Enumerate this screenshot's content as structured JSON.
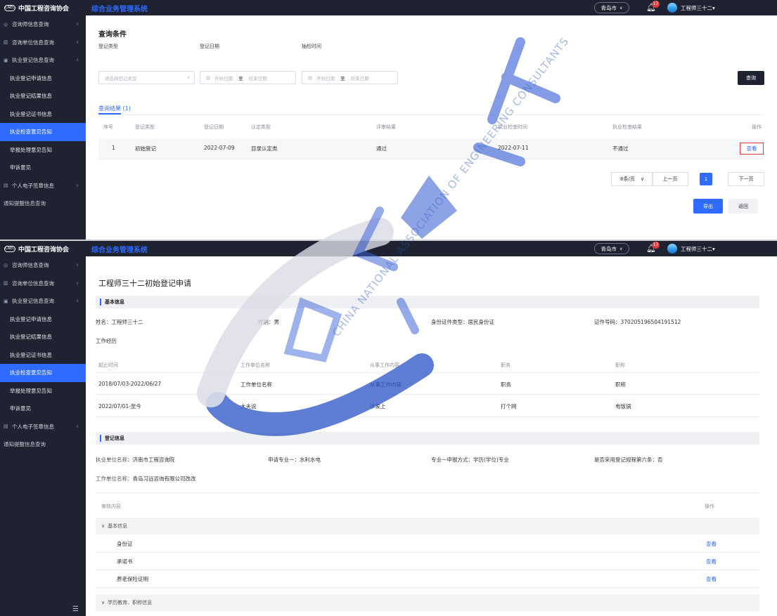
{
  "header": {
    "logo_mark": "CAEC",
    "logo_text": "中国工程咨询协会",
    "app_title": "综合业务管理系统",
    "city": "青岛市",
    "notifications": "17",
    "user": "工程师三十二"
  },
  "sidebar": {
    "items": [
      {
        "label": "咨询师信息查询",
        "icon": "person-icon",
        "type": "group"
      },
      {
        "label": "咨询单位信息查询",
        "icon": "building-icon",
        "type": "group"
      },
      {
        "label": "执业登记信息查询",
        "icon": "folder-icon",
        "type": "group-open"
      },
      {
        "label": "执业登记申请信息",
        "type": "sub"
      },
      {
        "label": "执业登记结果信息",
        "type": "sub"
      },
      {
        "label": "执业登记证书信息",
        "type": "sub"
      },
      {
        "label": "执业检查意见告知",
        "type": "sub",
        "active": true
      },
      {
        "label": "举报处理意见告知",
        "type": "sub"
      },
      {
        "label": "申诉意见",
        "type": "sub"
      },
      {
        "label": "个人电子签章信息",
        "icon": "seal-icon",
        "type": "group"
      },
      {
        "label": "通知提醒信息查询",
        "type": "plain"
      }
    ]
  },
  "search": {
    "title": "查询条件",
    "reg_type_label": "登记类型",
    "reg_type_placeholder": "请选择登记类型",
    "reg_date_label": "登记日期",
    "sample_time_label": "抽检时间",
    "start_placeholder": "开始日期",
    "to": "至",
    "end_placeholder": "结束日期",
    "query_button": "查询"
  },
  "results": {
    "tab_label": "查询结果 (1)",
    "columns": [
      "序号",
      "登记类型",
      "登记日期",
      "认定类型",
      "评审结果",
      "执业检查时间",
      "执业检查结果",
      "操作"
    ],
    "rows": [
      [
        "1",
        "初始登记",
        "2022-07-09",
        "目录认定类",
        "通过",
        "2022-07-11",
        "不通过",
        "查看"
      ]
    ]
  },
  "pager": {
    "page_size": "8条/页",
    "prev": "上一页",
    "current": "1",
    "next": "下一页"
  },
  "actions": {
    "export": "导出",
    "back": "返回"
  },
  "detail": {
    "title": "工程师三十二初始登记申请",
    "basic_section": "基本信息",
    "name": "姓名：工程师三十二",
    "gender": "性别：男",
    "id_type": "身份证件类型：居民身份证",
    "id_no": "证件号码：370205196504191512",
    "work_history": "工作经历",
    "work_columns": [
      "起止时间",
      "工作单位名称",
      "从事工作内容",
      "职务",
      "职称"
    ],
    "work_rows": [
      [
        "2018/07/03-2022/06/27",
        "工作单位名称",
        "从事工作内容",
        "职务",
        "职称"
      ],
      [
        "2022/07/01-至今",
        "大夫说",
        "沙发上",
        "打个网",
        "电饭锅"
      ]
    ],
    "reg_section": "登记信息",
    "practice_unit_key": "执业单位名称：",
    "practice_unit": "济南市工程咨询院",
    "major": "申请专业一：水利水电",
    "major_way": "专业一申报方式：学历(学位)专业",
    "rule_six": "是否采用登记规程第六条：否",
    "work_unit_key": "工作单位名称：",
    "work_unit": "青岛习远咨询有限公司改改",
    "review_header": "审核内容",
    "op_header": "操作",
    "groups": [
      {
        "label": "基本信息",
        "items": [
          "身份证",
          "承诺书",
          "养老保险证明"
        ]
      },
      {
        "label": "学历教育、职称信息",
        "items": []
      }
    ],
    "view": "查看"
  },
  "watermark_text": "CHINA NATIONAL ASSOCIATION OF ENGINEERING CONSULTANTS",
  "colors": {
    "primary": "#2f6bff",
    "dark": "#1e2231",
    "alert": "#e23a3a"
  }
}
